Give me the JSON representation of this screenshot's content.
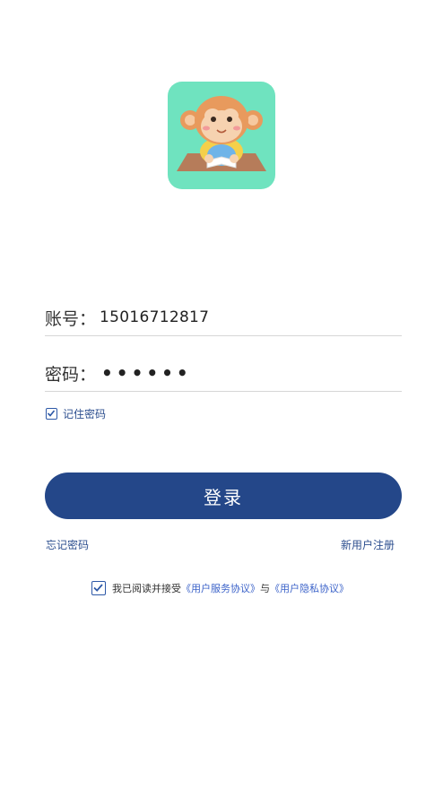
{
  "login": {
    "account_label": "账号：",
    "account_value": "15016712817",
    "password_label": "密码：",
    "password_mask": "••••••",
    "remember_label": "记住密码",
    "remember_checked": true,
    "submit_label": "登录",
    "forgot_label": "忘记密码",
    "register_label": "新用户注册"
  },
  "agreement": {
    "checked": true,
    "prefix": "我已阅读并接受",
    "service_link": "《用户服务协议》",
    "conjunction": "与",
    "privacy_link": "《用户隐私协议》"
  },
  "colors": {
    "primary": "#244789",
    "link": "#3c63c9",
    "logo_bg": "#6fe3bf"
  }
}
